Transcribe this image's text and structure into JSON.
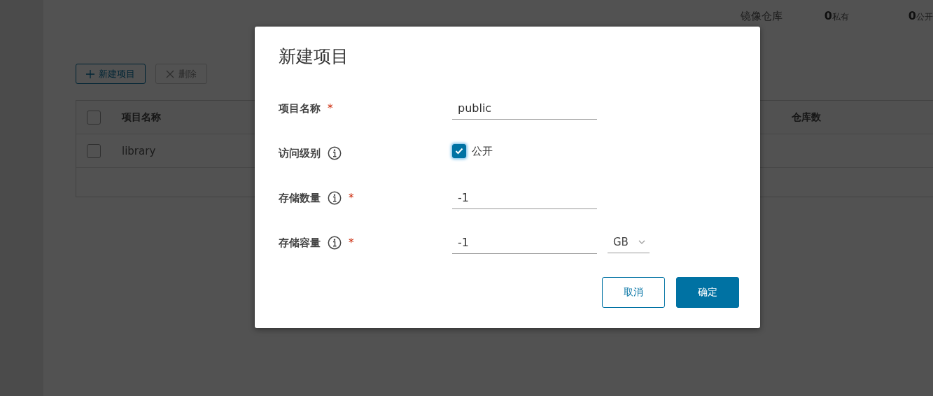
{
  "background": {
    "stats": [
      {
        "label": "镜像仓库"
      },
      {
        "value": "0",
        "label": "私有"
      },
      {
        "value": "0",
        "label": "公开"
      }
    ],
    "toolbar": [
      {
        "kind": "add",
        "label": "新建项目",
        "disabled": false
      },
      {
        "kind": "delete",
        "label": "删除",
        "disabled": true
      }
    ],
    "table": {
      "header_checked": false,
      "columns": [
        "项目名称",
        "仓库数"
      ],
      "rows": [
        {
          "name": "library",
          "checked": false
        }
      ]
    }
  },
  "dialog": {
    "title": "新建项目",
    "fields": [
      {
        "kind": "text",
        "label": "项目名称",
        "info": false,
        "required_mark": "*",
        "value": "public"
      },
      {
        "kind": "checkbox",
        "label": "访问级别",
        "info": true,
        "checked": true,
        "option": "公开"
      },
      {
        "kind": "text",
        "label": "存储数量",
        "info": true,
        "required_mark": "*",
        "value": "-1"
      },
      {
        "kind": "text",
        "label": "存储容量",
        "info": true,
        "required_mark": "*",
        "value": "-1",
        "unit": "GB"
      }
    ],
    "buttons": [
      {
        "kind": "secondary",
        "label": "取消"
      },
      {
        "kind": "primary",
        "label": "确定"
      }
    ]
  }
}
